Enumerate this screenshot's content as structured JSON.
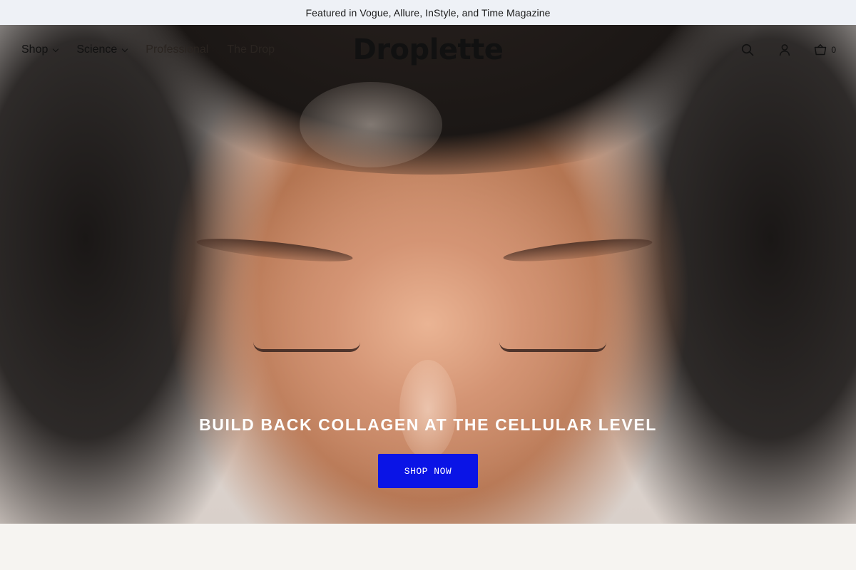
{
  "announcement": {
    "text": "Featured in Vogue, Allure, InStyle, and Time Magazine"
  },
  "nav": {
    "items": [
      {
        "label": "Shop",
        "has_dropdown": true
      },
      {
        "label": "Science",
        "has_dropdown": true
      },
      {
        "label": "Professional",
        "has_dropdown": false
      },
      {
        "label": "The Drop",
        "has_dropdown": false
      }
    ],
    "logo": "Droplette",
    "icons": [
      "search-icon",
      "account-icon",
      "cart-icon"
    ],
    "cart_count": "0"
  },
  "hero": {
    "title": "BUILD BACK COLLAGEN AT THE CELLULAR LEVEL",
    "cta_label": "SHOP NOW"
  },
  "colors": {
    "announcement_bg": "#eef1f6",
    "cta_bg": "#0a14e6",
    "text": "#111111"
  }
}
